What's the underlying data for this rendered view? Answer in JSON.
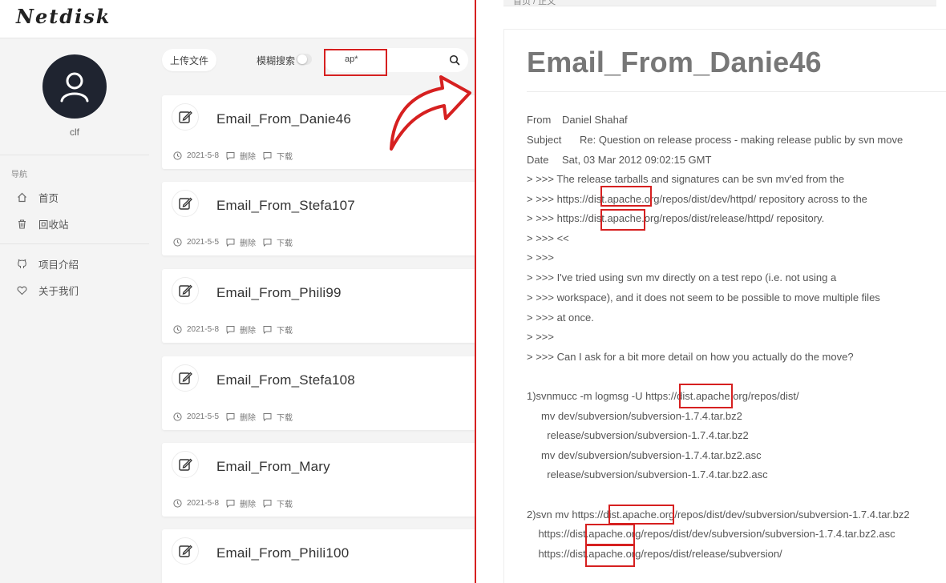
{
  "app": {
    "logo": "Netdisk"
  },
  "user": {
    "name": "clf"
  },
  "nav": {
    "title": "导航",
    "items": [
      {
        "label": "首页",
        "icon": "home-icon"
      },
      {
        "label": "回收站",
        "icon": "trash-icon"
      },
      {
        "label": "项目介绍",
        "icon": "github-icon"
      },
      {
        "label": "关于我们",
        "icon": "heart-icon"
      }
    ]
  },
  "toolbar": {
    "upload_label": "上传文件",
    "fuzzy_label": "模糊搜索",
    "search_value": "ap*"
  },
  "files": [
    {
      "name": "Email_From_Danie46",
      "date": "2021-5-8",
      "delete": "删除",
      "download": "下载"
    },
    {
      "name": "Email_From_Stefa107",
      "date": "2021-5-5",
      "delete": "删除",
      "download": "下载"
    },
    {
      "name": "Email_From_Phili99",
      "date": "2021-5-8",
      "delete": "删除",
      "download": "下载"
    },
    {
      "name": "Email_From_Stefa108",
      "date": "2021-5-5",
      "delete": "删除",
      "download": "下载"
    },
    {
      "name": "Email_From_Mary",
      "date": "2021-5-8",
      "delete": "删除",
      "download": "下载"
    },
    {
      "name": "Email_From_Phili100",
      "date": "",
      "delete": "",
      "download": ""
    }
  ],
  "doc": {
    "breadcrumb": "首页 / 正文",
    "title": "Email_From_Danie46",
    "from_key": "From",
    "from": "Daniel Shahaf",
    "subject_key": "Subject",
    "subject": "Re: Question on release process - making release public by svn move",
    "date_key": "Date",
    "date": "Sat, 03 Mar 2012 09:02:15 GMT",
    "lines": [
      "> >>> The release tarballs and signatures can be svn mv'ed from the",
      "> >>> https://dist.apache.org/repos/dist/dev/httpd/ repository across to the",
      "> >>> https://dist.apache.org/repos/dist/release/httpd/ repository.",
      "> >>> <<",
      "> >>>",
      "> >>> I've tried using svn mv directly on a test repo (i.e. not using a",
      "> >>> workspace), and it does not seem to be possible to move multiple files",
      "> >>> at once.",
      "> >>>",
      "> >>> Can I ask for a bit more detail on how you actually do the move?",
      "",
      "1)svnmucc -m logmsg -U https://dist.apache.org/repos/dist/",
      "     mv dev/subversion/subversion-1.7.4.tar.bz2",
      "       release/subversion/subversion-1.7.4.tar.bz2",
      "     mv dev/subversion/subversion-1.7.4.tar.bz2.asc",
      "       release/subversion/subversion-1.7.4.tar.bz2.asc",
      "",
      "2)svn mv https://dist.apache.org/repos/dist/dev/subversion/subversion-1.7.4.tar.bz2",
      "    https://dist.apache.org/repos/dist/dev/subversion/subversion-1.7.4.tar.bz2.asc",
      "    https://dist.apache.org/repos/dist/release/subversion/"
    ]
  },
  "colors": {
    "highlight": "#d62020",
    "avatar_bg": "#1f2430"
  }
}
